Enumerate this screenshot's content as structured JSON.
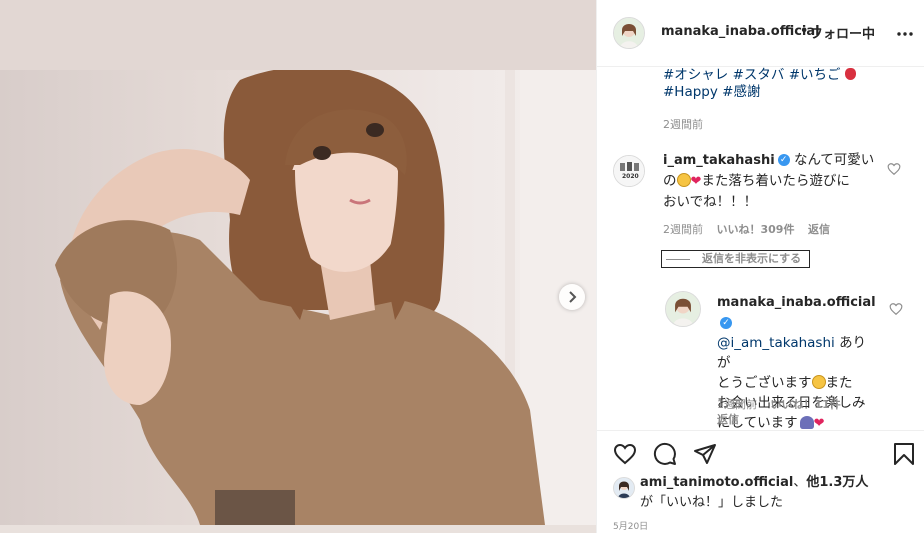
{
  "post": {
    "account": "manaka_inaba.official",
    "separator": "•",
    "follow_state": "フォロー中",
    "caption_line1": "#オシャレ #スタバ #いちご",
    "caption_line2": "#Happy #感謝",
    "caption_time": "2週間前"
  },
  "comment1": {
    "username": "i_am_takahashi",
    "text_part1": "なんて可愛い",
    "text_part2": "の",
    "text_part3": "また落ち着いたら遊びに",
    "text_part4": "おいでね！！！",
    "avatar_text": "2020",
    "time": "2週間前",
    "likes": "いいね！309件",
    "reply": "返信",
    "hide_replies": "返信を非表示にする"
  },
  "reply1": {
    "username": "manaka_inaba.official",
    "mention": "@i_am_takahashi",
    "text_part1": "ありが",
    "text_part2": "とうございます",
    "text_part3": "また",
    "text_part4": "お会い出来る日を楽しみ",
    "text_part5": "にしています",
    "time": "1週間前",
    "likes": "いいね！11件",
    "reply": "返信"
  },
  "likes_summary": {
    "user": "ami_tanimoto.official",
    "mid": "、",
    "others": "他1.3万人",
    "line2_prefix": "が「いいね！」しました"
  },
  "date": "5月20日",
  "colors": {
    "accent": "#3897f0",
    "link": "#00376b",
    "heart": "#e0245e"
  },
  "icons": [
    "heart-icon",
    "comment-icon",
    "share-icon",
    "bookmark-icon",
    "more-icon",
    "chevron-right-icon",
    "verified-icon"
  ]
}
